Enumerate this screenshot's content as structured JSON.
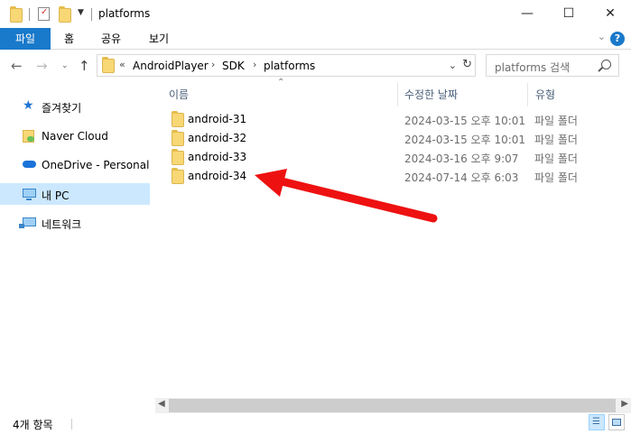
{
  "window": {
    "title": "platforms",
    "minimize_icon": "minimize-icon",
    "maximize_icon": "maximize-icon",
    "close_icon": "close-icon"
  },
  "ribbon": {
    "file_tab": "파일",
    "tabs": [
      "홈",
      "공유",
      "보기"
    ]
  },
  "address": {
    "overflow_label": "«",
    "breadcrumbs": [
      "AndroidPlayer",
      "SDK",
      "platforms"
    ],
    "search_placeholder": "platforms 검색"
  },
  "nav_pane": {
    "items": [
      {
        "label": "즐겨찾기",
        "icon": "star-icon"
      },
      {
        "label": "Naver Cloud",
        "icon": "cloud-folder-icon"
      },
      {
        "label": "OneDrive - Personal",
        "icon": "onedrive-icon"
      },
      {
        "label": "내 PC",
        "icon": "pc-icon",
        "selected": true
      },
      {
        "label": "네트워크",
        "icon": "network-icon"
      }
    ]
  },
  "columns": {
    "name": "이름",
    "date": "수정한 날짜",
    "type": "유형"
  },
  "rows": [
    {
      "name": "android-31",
      "date": "2024-03-15 오후 10:01",
      "type": "파일 폴더"
    },
    {
      "name": "android-32",
      "date": "2024-03-15 오후 10:01",
      "type": "파일 폴더"
    },
    {
      "name": "android-33",
      "date": "2024-03-16 오후 9:07",
      "type": "파일 폴더"
    },
    {
      "name": "android-34",
      "date": "2024-07-14 오후 6:03",
      "type": "파일 폴더"
    }
  ],
  "status": {
    "item_count": "4개 항목"
  },
  "colors": {
    "accent": "#1979ca",
    "selection": "#cce8ff",
    "annotation_arrow": "#ee1111"
  }
}
